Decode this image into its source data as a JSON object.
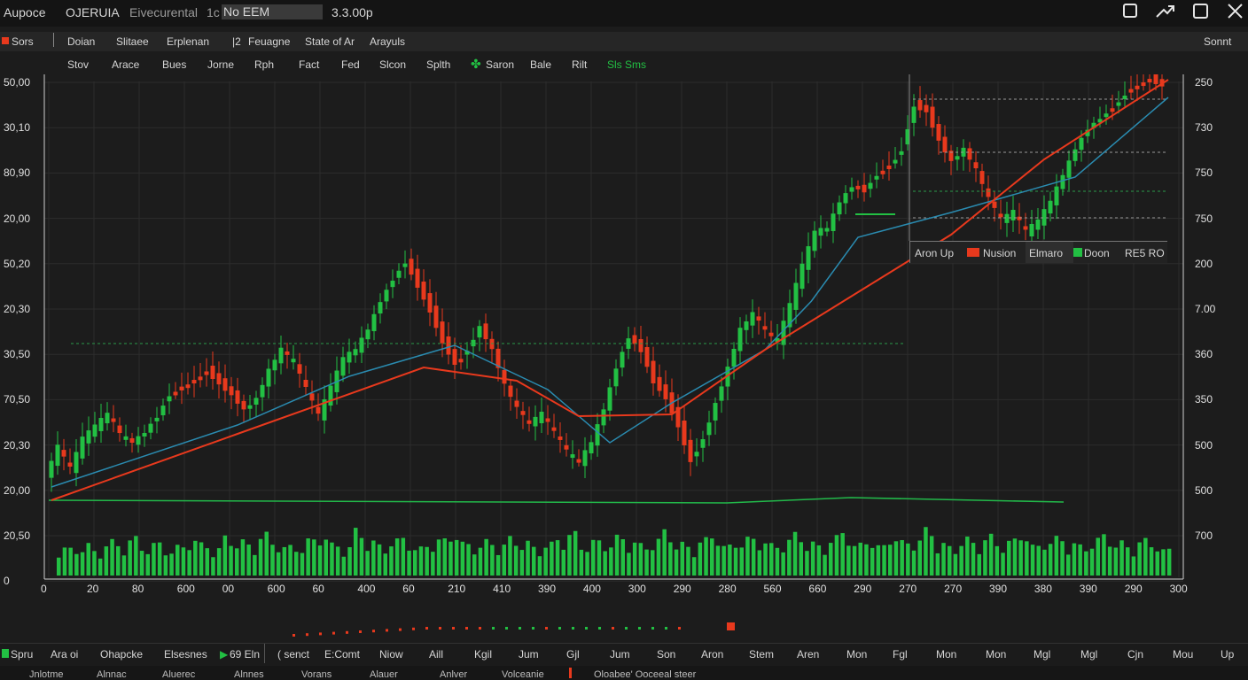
{
  "titlebar": {
    "app_name": "Aupoce",
    "symbol": "OJERUIA",
    "environment": "Eivecurental",
    "interval": "1c",
    "ticker": "No EEM",
    "price": "3.3.00p"
  },
  "menubar": {
    "items": [
      "Sors",
      "Doian",
      "Slitaee",
      "Erplenan",
      "|2",
      "Feuagne",
      "State of Ar",
      "Arayuls"
    ],
    "right": "Sonnt"
  },
  "toolbar": {
    "items": [
      "Stov",
      "Arace",
      "Bues",
      "Jorne",
      "Rph",
      "Fact",
      "Fed",
      "Slcon",
      "Splth",
      "Saron",
      "Bale",
      "Rilt",
      "Sls Sms"
    ]
  },
  "colors": {
    "up": "#22c043",
    "down": "#e8391d",
    "ma_slow": "#e8391d",
    "ma_fast": "#2a8bb0",
    "baseline": "#22b94a",
    "bg": "#1c1c1c",
    "grid": "#2c2c2c"
  },
  "legend": {
    "items": [
      "Aron Up",
      "Nusion",
      "Elmaro",
      "Doon",
      "RE5 RO"
    ]
  },
  "chart_data": {
    "type": "candlestick",
    "y_left_ticks": [
      "50,00",
      "30,10",
      "80,90",
      "20,00",
      "50,20",
      "20,30",
      "30,50",
      "70,50",
      "20,30",
      "20,00",
      "20,50",
      "0"
    ],
    "y_right_ticks": [
      "250",
      "730",
      "750",
      "750",
      "200",
      "7.00",
      "360",
      "350",
      "500",
      "500",
      "700"
    ],
    "x_ticks": [
      "0",
      "20",
      "80",
      "600",
      "00",
      "600",
      "60",
      "400",
      "60",
      "210",
      "410",
      "390",
      "400",
      "300",
      "290",
      "280",
      "560",
      "660",
      "290",
      "270",
      "270",
      "390",
      "380",
      "390",
      "290",
      "300"
    ],
    "price_path": [
      [
        0,
        538
      ],
      [
        4,
        505
      ],
      [
        8,
        530
      ],
      [
        12,
        496
      ],
      [
        16,
        482
      ],
      [
        20,
        468
      ],
      [
        24,
        490
      ],
      [
        28,
        500
      ],
      [
        32,
        488
      ],
      [
        36,
        470
      ],
      [
        40,
        445
      ],
      [
        44,
        438
      ],
      [
        48,
        430
      ],
      [
        52,
        418
      ],
      [
        56,
        432
      ],
      [
        60,
        445
      ],
      [
        64,
        462
      ],
      [
        68,
        450
      ],
      [
        72,
        418
      ],
      [
        76,
        395
      ],
      [
        80,
        408
      ],
      [
        84,
        440
      ],
      [
        88,
        470
      ],
      [
        92,
        438
      ],
      [
        96,
        405
      ],
      [
        100,
        395
      ],
      [
        104,
        372
      ],
      [
        108,
        340
      ],
      [
        112,
        315
      ],
      [
        116,
        295
      ],
      [
        120,
        322
      ],
      [
        124,
        350
      ],
      [
        128,
        385
      ],
      [
        132,
        410
      ],
      [
        136,
        395
      ],
      [
        140,
        368
      ],
      [
        144,
        395
      ],
      [
        148,
        435
      ],
      [
        152,
        462
      ],
      [
        156,
        478
      ],
      [
        160,
        468
      ],
      [
        164,
        488
      ],
      [
        168,
        510
      ],
      [
        172,
        522
      ],
      [
        176,
        500
      ],
      [
        180,
        462
      ],
      [
        184,
        415
      ],
      [
        188,
        380
      ],
      [
        192,
        395
      ],
      [
        196,
        430
      ],
      [
        200,
        448
      ],
      [
        204,
        480
      ],
      [
        208,
        520
      ],
      [
        212,
        495
      ],
      [
        216,
        455
      ],
      [
        220,
        415
      ],
      [
        224,
        372
      ],
      [
        228,
        355
      ],
      [
        232,
        372
      ],
      [
        236,
        385
      ],
      [
        240,
        345
      ],
      [
        244,
        300
      ],
      [
        248,
        262
      ],
      [
        252,
        258
      ],
      [
        256,
        228
      ],
      [
        260,
        210
      ],
      [
        264,
        215
      ],
      [
        268,
        196
      ],
      [
        272,
        188
      ],
      [
        276,
        168
      ],
      [
        280,
        118
      ],
      [
        284,
        125
      ],
      [
        288,
        158
      ],
      [
        292,
        182
      ],
      [
        296,
        168
      ],
      [
        300,
        192
      ],
      [
        304,
        225
      ],
      [
        308,
        248
      ],
      [
        312,
        240
      ],
      [
        316,
        262
      ],
      [
        320,
        250
      ],
      [
        324,
        228
      ],
      [
        328,
        198
      ],
      [
        332,
        168
      ],
      [
        336,
        145
      ],
      [
        340,
        132
      ],
      [
        344,
        122
      ],
      [
        348,
        105
      ],
      [
        352,
        98
      ],
      [
        356,
        88
      ],
      [
        360,
        96
      ]
    ],
    "ma_slow": [
      [
        0,
        565
      ],
      [
        60,
        490
      ],
      [
        120,
        415
      ],
      [
        150,
        430
      ],
      [
        170,
        470
      ],
      [
        200,
        468
      ],
      [
        230,
        395
      ],
      [
        260,
        330
      ],
      [
        290,
        265
      ],
      [
        320,
        180
      ],
      [
        360,
        90
      ]
    ],
    "ma_fast": [
      [
        0,
        550
      ],
      [
        60,
        480
      ],
      [
        96,
        425
      ],
      [
        130,
        390
      ],
      [
        160,
        440
      ],
      [
        180,
        500
      ],
      [
        200,
        455
      ],
      [
        230,
        395
      ],
      [
        245,
        340
      ],
      [
        260,
        268
      ],
      [
        290,
        240
      ],
      [
        330,
        200
      ],
      [
        360,
        110
      ]
    ],
    "volume": [
      45,
      42,
      50,
      38,
      55,
      48,
      60,
      44,
      52,
      40,
      47,
      58,
      50,
      43,
      61,
      55,
      49,
      66,
      52,
      47,
      44,
      58,
      63,
      50,
      46,
      72,
      54,
      48,
      56,
      61,
      44,
      50,
      58,
      66,
      52,
      47,
      55,
      49,
      60,
      53,
      45,
      51,
      59,
      68,
      47,
      56,
      50,
      62,
      54,
      49,
      57,
      71,
      51,
      46,
      58,
      64,
      48,
      53,
      60,
      55,
      49,
      57,
      66,
      52,
      47,
      61,
      70,
      50,
      56,
      48,
      62,
      54,
      58,
      73,
      51,
      45,
      59,
      52,
      63,
      50,
      57,
      66,
      48,
      55,
      60,
      52,
      47,
      58,
      64,
      53,
      46,
      57,
      50,
      42
    ]
  },
  "bottombar": {
    "items": [
      "Spru",
      "Ara oi",
      "Ohapcke",
      "Elsesnes",
      "69 Eln",
      "( senct",
      "E:Comt",
      "Niow",
      "Aill",
      "Kgil",
      "Jum",
      "Gjl",
      "Jum",
      "Son",
      "Aron",
      "Stem",
      "Aren",
      "Mon",
      "Fgl",
      "Mon",
      "Mon",
      "Mgl",
      "Mgl",
      "Cjn",
      "Mou",
      "Up"
    ]
  },
  "statusbar": {
    "items": [
      "Jnlotme",
      "Alnnac",
      "Aluerec",
      "Alnnes",
      "Vorans",
      "Alauer",
      "Anlver",
      "Volceanie",
      "Oloabee' Ooceeal steer"
    ]
  }
}
